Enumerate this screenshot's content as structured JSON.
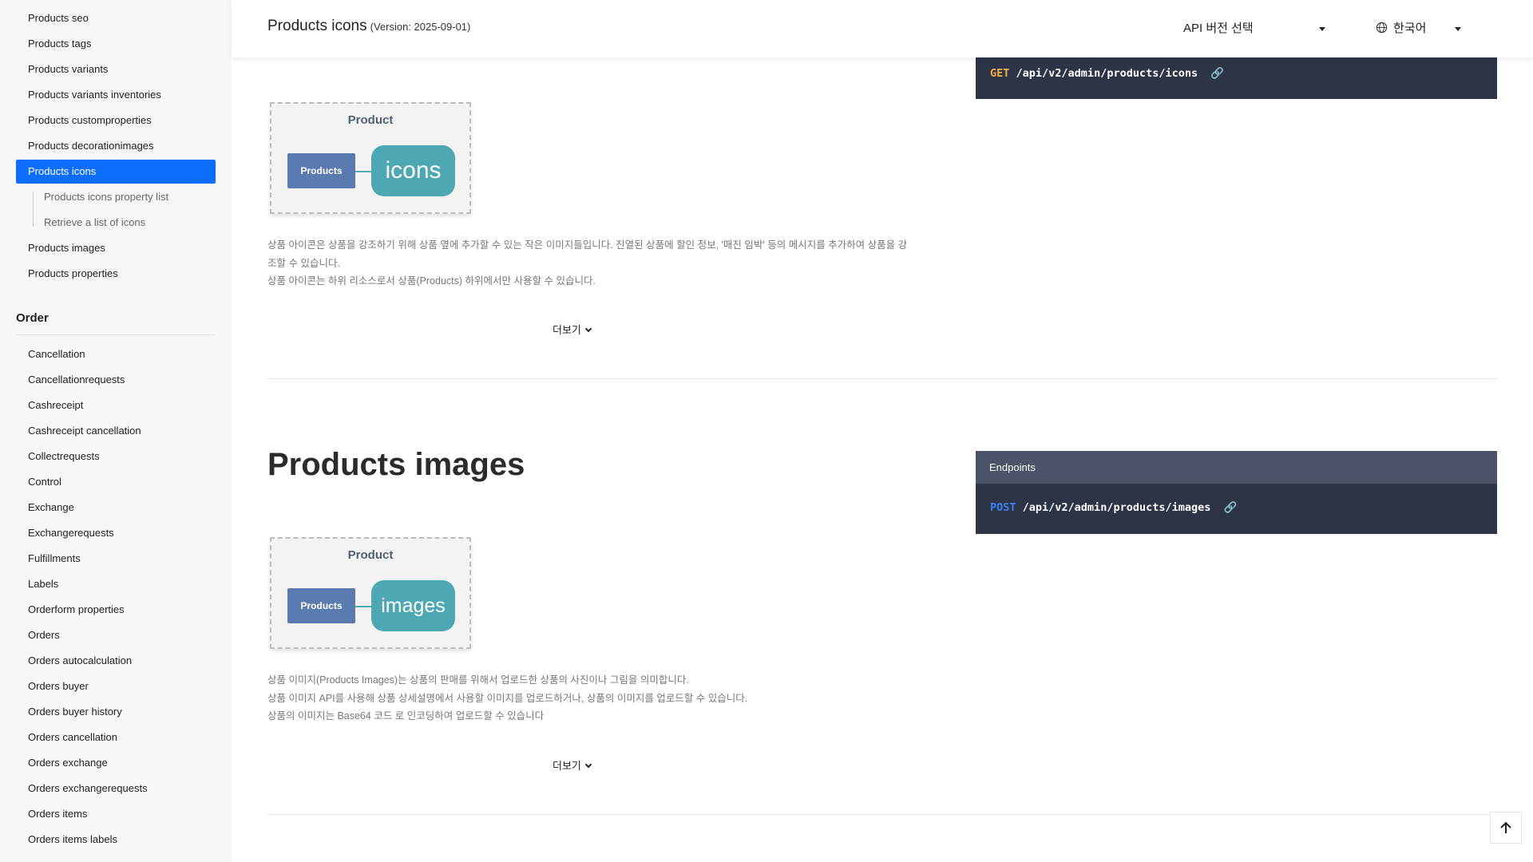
{
  "sidebar": {
    "items_top": [
      {
        "label": "Products seo"
      },
      {
        "label": "Products tags"
      },
      {
        "label": "Products variants"
      },
      {
        "label": "Products variants inventories"
      },
      {
        "label": "Products customproperties"
      },
      {
        "label": "Products decorationimages"
      },
      {
        "label": "Products icons"
      }
    ],
    "sub_items": [
      {
        "label": "Products icons property list"
      },
      {
        "label": "Retrieve a list of icons"
      }
    ],
    "items_after": [
      {
        "label": "Products images"
      },
      {
        "label": "Products properties"
      }
    ],
    "group_order": "Order",
    "order_items": [
      {
        "label": "Cancellation"
      },
      {
        "label": "Cancellationrequests"
      },
      {
        "label": "Cashreceipt"
      },
      {
        "label": "Cashreceipt cancellation"
      },
      {
        "label": "Collectrequests"
      },
      {
        "label": "Control"
      },
      {
        "label": "Exchange"
      },
      {
        "label": "Exchangerequests"
      },
      {
        "label": "Fulfillments"
      },
      {
        "label": "Labels"
      },
      {
        "label": "Orderform properties"
      },
      {
        "label": "Orders"
      },
      {
        "label": "Orders autocalculation"
      },
      {
        "label": "Orders buyer"
      },
      {
        "label": "Orders buyer history"
      },
      {
        "label": "Orders cancellation"
      },
      {
        "label": "Orders exchange"
      },
      {
        "label": "Orders exchangerequests"
      },
      {
        "label": "Orders items"
      },
      {
        "label": "Orders items labels"
      }
    ]
  },
  "header": {
    "title": "Products icons",
    "version": "(Version: 2025-09-01)",
    "api_select": "API 버전 선택",
    "language": "한국어"
  },
  "icons_section": {
    "diagram": {
      "title": "Product",
      "box": "Products",
      "pill": "icons"
    },
    "endpoint_method": "GET",
    "endpoint_path": "/api/v2/admin/products/icons",
    "desc_lines": [
      "상품 아이콘은 상품을 강조하기 위해 상품 옆에 추가할 수 있는 작은 이미지들입니다. 진열된 상품에 할인 정보, '매진 임박' 등의 메시지를 추가하여 상품을 강",
      "조할 수 있습니다.",
      "상품 아이콘는 하위 리소스로서 상품(Products) 하위에서만 사용할 수 있습니다."
    ],
    "more": "더보기"
  },
  "images_section": {
    "title": "Products images",
    "diagram": {
      "title": "Product",
      "box": "Products",
      "pill": "images"
    },
    "endpoints_label": "Endpoints",
    "endpoint_method": "POST",
    "endpoint_path": "/api/v2/admin/products/images",
    "desc_lines": [
      "상품 이미지(Products Images)는 상품의 판매를 위해서 업로드한 상품의 사진이나 그림을 의미합니다.",
      "상품 이미지 API를 사용해 상품 상세설명에서 사용할 이미지를 업로드하거나, 상품의 이미지를 업로드할 수 있습니다.",
      "상품의 이미지는 Base64 코드 로 인코딩하여 업로드할 수 있습니다"
    ],
    "more": "더보기"
  },
  "scroll_top_icon": "arrow-up-icon"
}
